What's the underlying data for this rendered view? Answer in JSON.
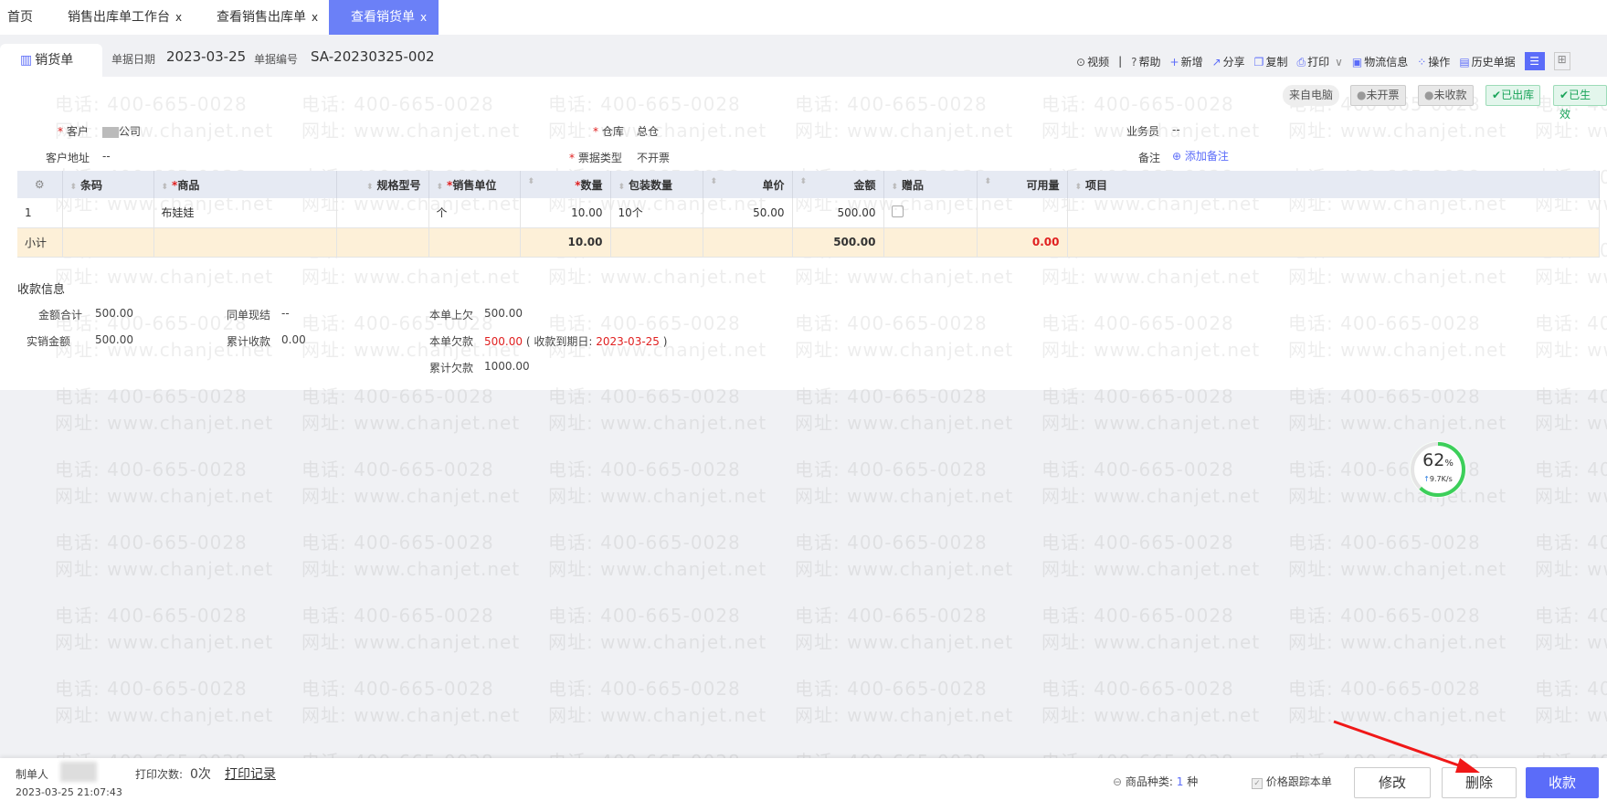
{
  "tabs": [
    {
      "label": "首页"
    },
    {
      "label": "销售出库单工作台",
      "close": "x"
    },
    {
      "label": "查看销售出库单",
      "close": "x"
    },
    {
      "label": "查看销货单",
      "close": "x"
    }
  ],
  "doc": {
    "title": "销货单",
    "date_label": "单据日期",
    "date": "2023-03-25",
    "no_label": "单据编号",
    "no": "SA-20230325-002"
  },
  "toolbar": [
    "视频",
    "帮助",
    "新增",
    "分享",
    "复制",
    "打印",
    "物流信息",
    "操作",
    "历史单据"
  ],
  "toolbar_divider": "|",
  "badges": [
    {
      "label": "来自电脑"
    },
    {
      "label": "未开票"
    },
    {
      "label": "未收款"
    },
    {
      "label": "已出库"
    },
    {
      "label": "已生效"
    }
  ],
  "form": {
    "customer_label": "客户",
    "customer": "公司",
    "address_label": "客户地址",
    "address": "--",
    "warehouse_label": "仓库",
    "warehouse": "总仓",
    "invoice_label": "票据类型",
    "invoice": "不开票",
    "salesman_label": "业务员",
    "salesman": "--",
    "note_label": "备注",
    "note_add": "添加备注"
  },
  "table": {
    "headers": [
      "条码",
      "商品",
      "规格型号",
      "销售单位",
      "数量",
      "包装数量",
      "单价",
      "金额",
      "赠品",
      "可用量",
      "项目"
    ],
    "rows": [
      {
        "no": "1",
        "barcode": "",
        "product": "布娃娃",
        "spec": "",
        "unit": "个",
        "qty": "10.00",
        "pack": "10个",
        "price": "50.00",
        "amount": "500.00",
        "avail": ""
      }
    ],
    "subtotal": {
      "label": "小计",
      "qty": "10.00",
      "amount": "500.00",
      "avail": "0.00"
    }
  },
  "payment": {
    "title": "收款信息",
    "total_label": "金额合计",
    "total": "500.00",
    "actual_label": "实销金额",
    "actual": "500.00",
    "cash_label": "同单现结",
    "cash": "--",
    "received_label": "累计收款",
    "received": "0.00",
    "prev_label": "本单上欠",
    "prev": "500.00",
    "owed_label": "本单欠款",
    "owed": "500.00",
    "due_label": "收款到期日:",
    "due": "2023-03-25",
    "cum_label": "累计欠款",
    "cum": "1000.00"
  },
  "gauge": {
    "percent": "62",
    "unit": "%",
    "speed": "9.7K/s",
    "value": 0.62
  },
  "footer": {
    "maker_label": "制单人",
    "time": "2023-03-25 21:07:43",
    "print_label": "打印次数:",
    "print_count": "0次",
    "print_log": "打印记录",
    "kinds_label": "商品种类:",
    "kinds": "1",
    "kinds_unit": "种",
    "track_label": "价格跟踪本单",
    "edit": "修改",
    "delete": "删除",
    "collect": "收款"
  },
  "watermark": {
    "phone": "电话: 400-665-0028",
    "site": "网址: www.chanjet.net"
  },
  "colors": {
    "accent": "#5b6cf9",
    "red": "#e02020",
    "green": "#1aa45a"
  }
}
